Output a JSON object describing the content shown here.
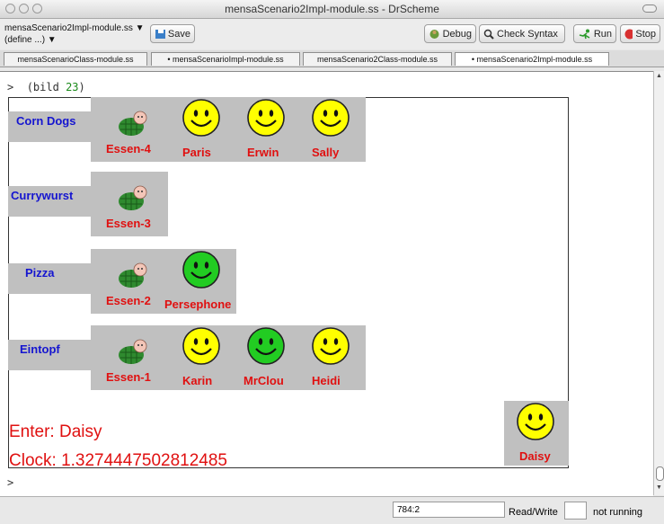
{
  "window": {
    "title": "mensaScenario2Impl-module.ss - DrScheme"
  },
  "toolbar": {
    "file_menu": "mensaScenario2Impl-module.ss ▼",
    "define_menu": "(define ...) ▼",
    "save_label": "Save",
    "debug_label": "Debug",
    "check_syntax_label": "Check Syntax",
    "run_label": "Run",
    "stop_label": "Stop"
  },
  "tabs": [
    {
      "label": "mensaScenarioClass-module.ss"
    },
    {
      "label": "• mensaScenarioImpl-module.ss"
    },
    {
      "label": "mensaScenario2Class-module.ss"
    },
    {
      "label": "• mensaScenario2Impl-module.ss"
    }
  ],
  "repl": {
    "prompt": ">",
    "expr_open": "(bild ",
    "expr_num": "23",
    "expr_close": ")",
    "bottom_prompt": ">"
  },
  "scene": {
    "rows": [
      {
        "dish": "Corn Dogs",
        "slot": "Essen-4",
        "people": [
          {
            "name": "Paris",
            "color": "#ffff00"
          },
          {
            "name": "Erwin",
            "color": "#ffff00"
          },
          {
            "name": "Sally",
            "color": "#ffff00"
          }
        ]
      },
      {
        "dish": "Currywurst",
        "slot": "Essen-3",
        "people": []
      },
      {
        "dish": "Pizza",
        "slot": "Essen-2",
        "people": [
          {
            "name": "Persephone",
            "color": "#22cc22"
          }
        ]
      },
      {
        "dish": "Eintopf",
        "slot": "Essen-1",
        "people": [
          {
            "name": "Karin",
            "color": "#ffff00"
          },
          {
            "name": "MrClou",
            "color": "#22cc22"
          },
          {
            "name": "Heidi",
            "color": "#ffff00"
          }
        ]
      }
    ],
    "enter_text": "Enter: Daisy",
    "clock_text": "Clock: 1.3274447502812485",
    "waiting": {
      "name": "Daisy",
      "color": "#ffff00"
    }
  },
  "status": {
    "position": "784:2",
    "mode": "Read/Write",
    "state": "not running"
  },
  "colors": {
    "dish_label": "#1515d0",
    "name_label": "#e01010",
    "box_gray": "#c0c0c0"
  }
}
